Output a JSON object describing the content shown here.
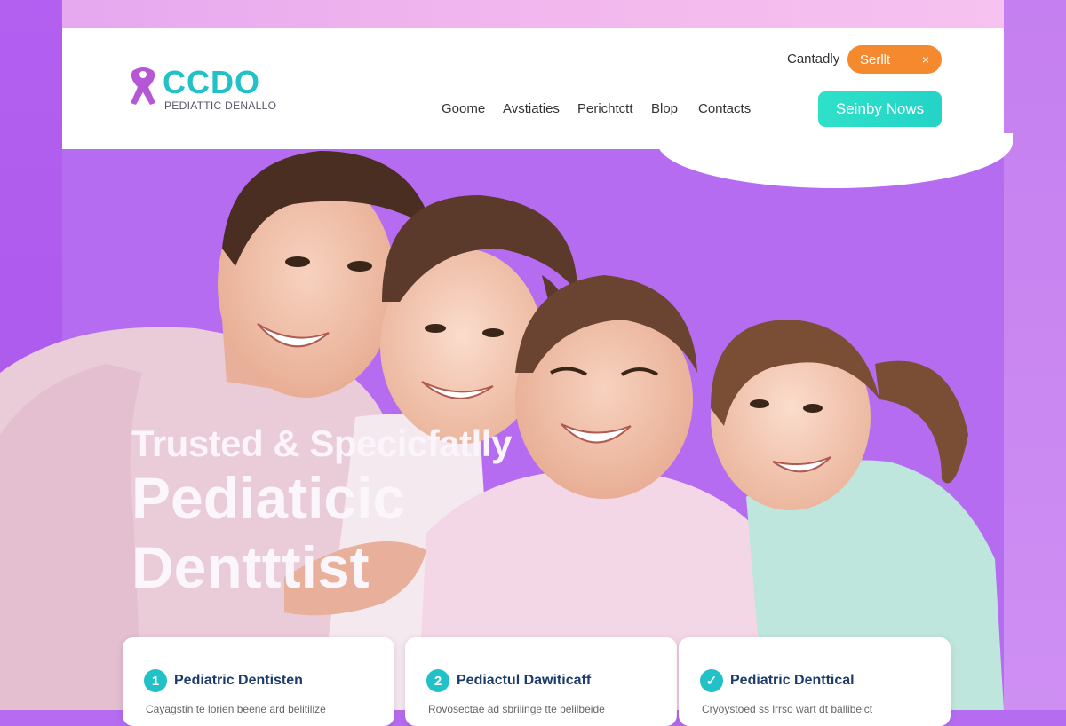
{
  "brand": {
    "name": "CCDO",
    "tagline": "PEDIATTIC DENALLO"
  },
  "header": {
    "contact_label": "Cantadly",
    "search": {
      "label": "Serllt",
      "close_icon": "×"
    },
    "cta_label": "Seinby Nows",
    "nav": [
      "Goome",
      "Avstiaties",
      "Perichtctt",
      "Blop",
      "Contacts"
    ]
  },
  "hero": {
    "line1": "Trusted & Specicfatlly",
    "line2": "Pediaticic",
    "line3": "Dentttist"
  },
  "cards": [
    {
      "number": "1",
      "title": "Pediatric Dentisten",
      "subtitle": "Cayagstin te lorien beene ard belitilize"
    },
    {
      "number": "2",
      "title": "Pediactul Dawiticaff",
      "subtitle": "Rovosectae ad sbrilinge tte belilbeide"
    },
    {
      "number": "✓",
      "title": "Pediatric Denttical",
      "subtitle": "Cryoystoed ss lrrso wart dt ballibeict"
    }
  ],
  "colors": {
    "background": "#b56cf0",
    "accent_teal": "#21c1c7",
    "accent_orange": "#f5892e",
    "card_title": "#1d3c6a"
  }
}
